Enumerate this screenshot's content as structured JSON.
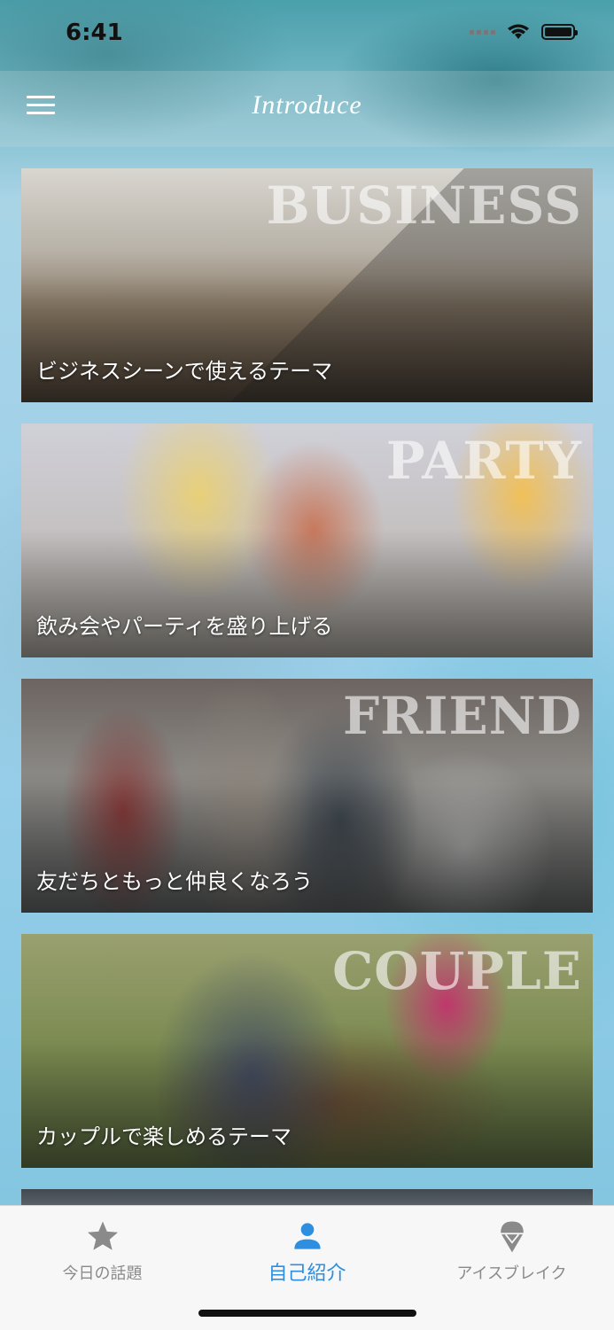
{
  "status_bar": {
    "time": "6:41"
  },
  "nav": {
    "title": "Introduce"
  },
  "cards": [
    {
      "english": "BUSINESS",
      "caption": "ビジネスシーンで使えるテーマ"
    },
    {
      "english": "PARTY",
      "caption": "飲み会やパーティを盛り上げる"
    },
    {
      "english": "FRIEND",
      "caption": "友だちともっと仲良くなろう"
    },
    {
      "english": "COUPLE",
      "caption": "カップルで楽しめるテーマ"
    }
  ],
  "tabs": [
    {
      "label": "今日の話題",
      "icon": "star-icon"
    },
    {
      "label": "自己紹介",
      "icon": "person-icon",
      "active": true
    },
    {
      "label": "アイスブレイク",
      "icon": "ice-cream-icon"
    }
  ],
  "colors": {
    "accent": "#2e8fe0",
    "inactive": "#8a8a8a"
  }
}
